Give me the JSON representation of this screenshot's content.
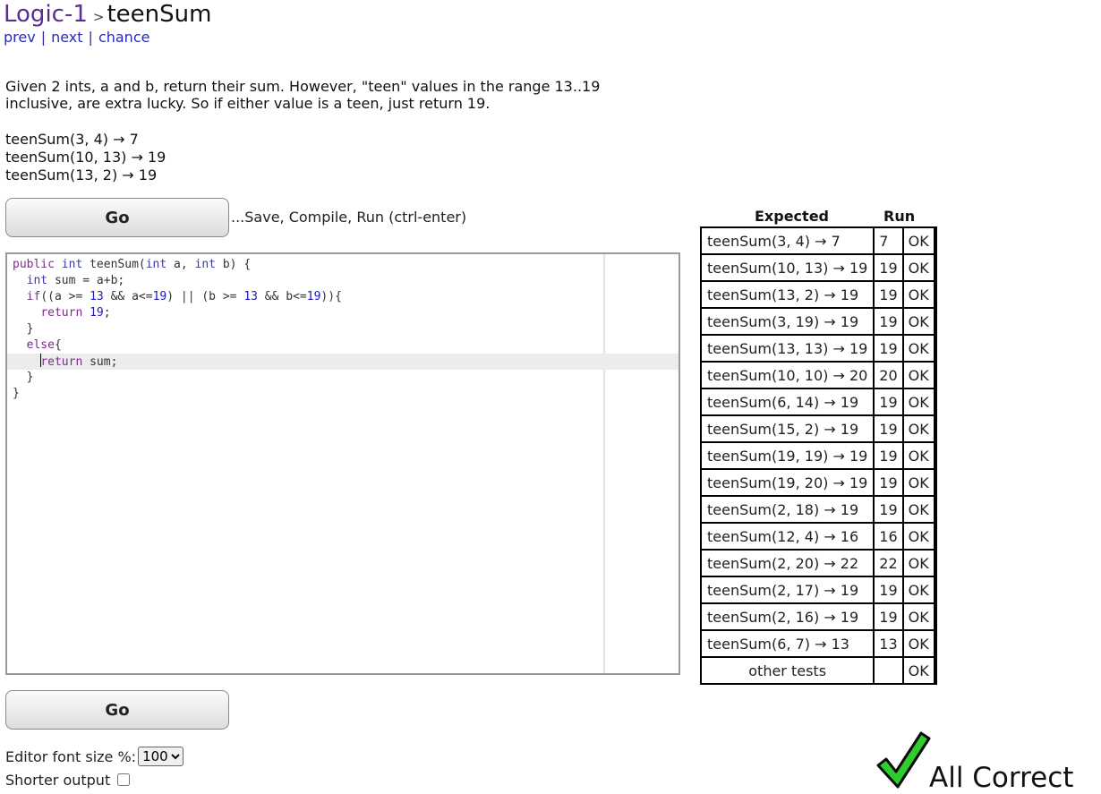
{
  "header": {
    "category": "Logic-1",
    "separator": ">",
    "problem": "teenSum"
  },
  "nav": {
    "prev": "prev",
    "next": "next",
    "chance": "chance",
    "divider": "|"
  },
  "description": {
    "line1": "Given 2 ints, a and b, return their sum. However, \"teen\" values in the range 13..19",
    "line2": "inclusive, are extra lucky. So if either value is a teen, just return 19."
  },
  "examples": [
    "teenSum(3, 4) → 7",
    "teenSum(10, 13) → 19",
    "teenSum(13, 2) → 19"
  ],
  "go_button": {
    "label": "Go",
    "hint": "...Save, Compile, Run (ctrl-enter)"
  },
  "editor": {
    "code_lines": [
      "public int teenSum(int a, int b) {",
      "  int sum = a+b;",
      "  if((a >= 13 && a<=19) || (b >= 13 && b<=19)){",
      "    return 19;",
      "  }",
      "  else{",
      "    return sum;",
      "  }",
      "}"
    ]
  },
  "results": {
    "header_expected": "Expected",
    "header_run": "Run",
    "rows": [
      {
        "expected": "teenSum(3, 4) → 7",
        "run": "7",
        "status": "OK"
      },
      {
        "expected": "teenSum(10, 13) → 19",
        "run": "19",
        "status": "OK"
      },
      {
        "expected": "teenSum(13, 2) → 19",
        "run": "19",
        "status": "OK"
      },
      {
        "expected": "teenSum(3, 19) → 19",
        "run": "19",
        "status": "OK"
      },
      {
        "expected": "teenSum(13, 13) → 19",
        "run": "19",
        "status": "OK"
      },
      {
        "expected": "teenSum(10, 10) → 20",
        "run": "20",
        "status": "OK"
      },
      {
        "expected": "teenSum(6, 14) → 19",
        "run": "19",
        "status": "OK"
      },
      {
        "expected": "teenSum(15, 2) → 19",
        "run": "19",
        "status": "OK"
      },
      {
        "expected": "teenSum(19, 19) → 19",
        "run": "19",
        "status": "OK"
      },
      {
        "expected": "teenSum(19, 20) → 19",
        "run": "19",
        "status": "OK"
      },
      {
        "expected": "teenSum(2, 18) → 19",
        "run": "19",
        "status": "OK"
      },
      {
        "expected": "teenSum(12, 4) → 16",
        "run": "16",
        "status": "OK"
      },
      {
        "expected": "teenSum(2, 20) → 22",
        "run": "22",
        "status": "OK"
      },
      {
        "expected": "teenSum(2, 17) → 19",
        "run": "19",
        "status": "OK"
      },
      {
        "expected": "teenSum(2, 16) → 19",
        "run": "19",
        "status": "OK"
      },
      {
        "expected": "teenSum(6, 7) → 13",
        "run": "13",
        "status": "OK"
      },
      {
        "expected": "other tests",
        "run": "",
        "status": "OK"
      }
    ],
    "pass_color": "#008000"
  },
  "settings": {
    "font_size_label": "Editor font size %:",
    "font_size_value": "100",
    "shorter_output_label": "Shorter output"
  },
  "summary": {
    "text": "All Correct",
    "check_icon": "green-checkmark-icon",
    "check_color": "#2ecc2e"
  },
  "colors": {
    "link": "#2b2bb5",
    "crumb": "#5a2d91"
  }
}
